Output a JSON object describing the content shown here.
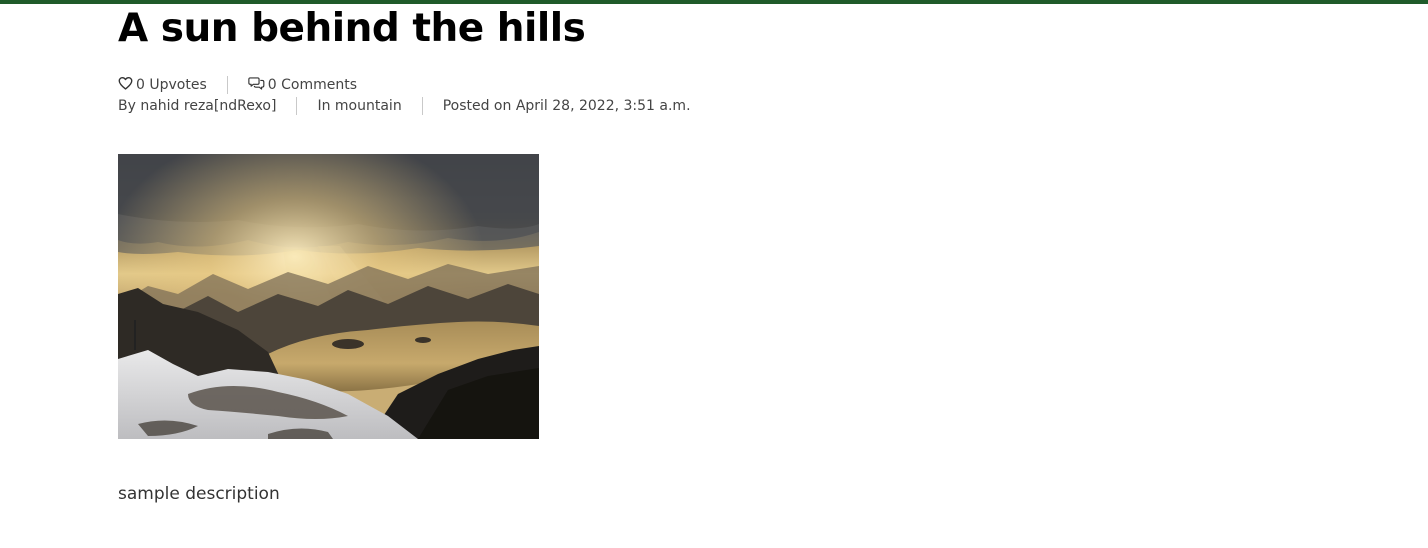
{
  "post": {
    "title": "A sun behind the hills",
    "stats": {
      "upvotes": "0 Upvotes",
      "comments": "0 Comments",
      "upvote_icon": "heart-icon",
      "comment_icon": "comments-icon"
    },
    "meta": {
      "author": "By nahid reza[ndRexo]",
      "category": "In mountain",
      "posted": "Posted on April 28, 2022, 3:51 a.m."
    },
    "image": {
      "subject": "sunlit mountain lake landscape photo"
    },
    "description": "sample description"
  },
  "colors": {
    "topbar": "#1f5b2a",
    "title": "#000000",
    "meta_text": "#444444",
    "separator": "#c9c9c9"
  }
}
